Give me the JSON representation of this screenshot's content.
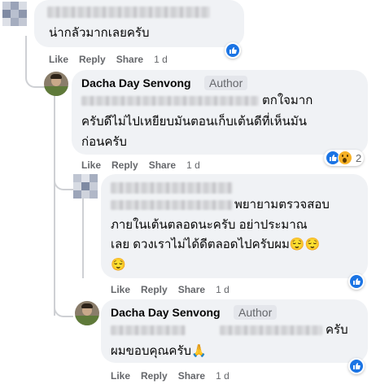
{
  "comments": [
    {
      "text_lines": [
        "น่ากลัวมากเลยครับ"
      ],
      "actions": {
        "like": "Like",
        "reply": "Reply",
        "share": "Share",
        "time": "1 d"
      }
    },
    {
      "author": "Dacha Day Senvong",
      "badge": "Author",
      "text_lines": [
        "ตกใจมาก",
        "ครับดีไม่ไปเหยียบมันตอนเก็บเต้นดีที่เห็นมัน",
        "ก่อนครับ"
      ],
      "reactions": {
        "count": "2",
        "icons": [
          "like-icon",
          "wow-icon"
        ]
      },
      "actions": {
        "like": "Like",
        "reply": "Reply",
        "share": "Share",
        "time": "1 d"
      }
    },
    {
      "text_lines": [
        "พยายามตรวจสอบ",
        "ภายในเต้นตลอดนะครับ อย่าประมาณ",
        "เลย ดวงเราไม่ได้ดีตลอดไปครับผม😌😌",
        "😌"
      ],
      "actions": {
        "like": "Like",
        "reply": "Reply",
        "share": "Share",
        "time": "1 d"
      }
    },
    {
      "author": "Dacha Day Senvong",
      "badge": "Author",
      "text_lines": [
        "ครับ",
        "ผมขอบคุณครับ🙏"
      ],
      "actions": {
        "like": "Like",
        "reply": "Reply",
        "share": "Share",
        "time": "1 d"
      }
    }
  ],
  "colors": {
    "like_blue": "#1b74e4",
    "bubble": "#f0f2f5",
    "secondary": "#65676b"
  }
}
